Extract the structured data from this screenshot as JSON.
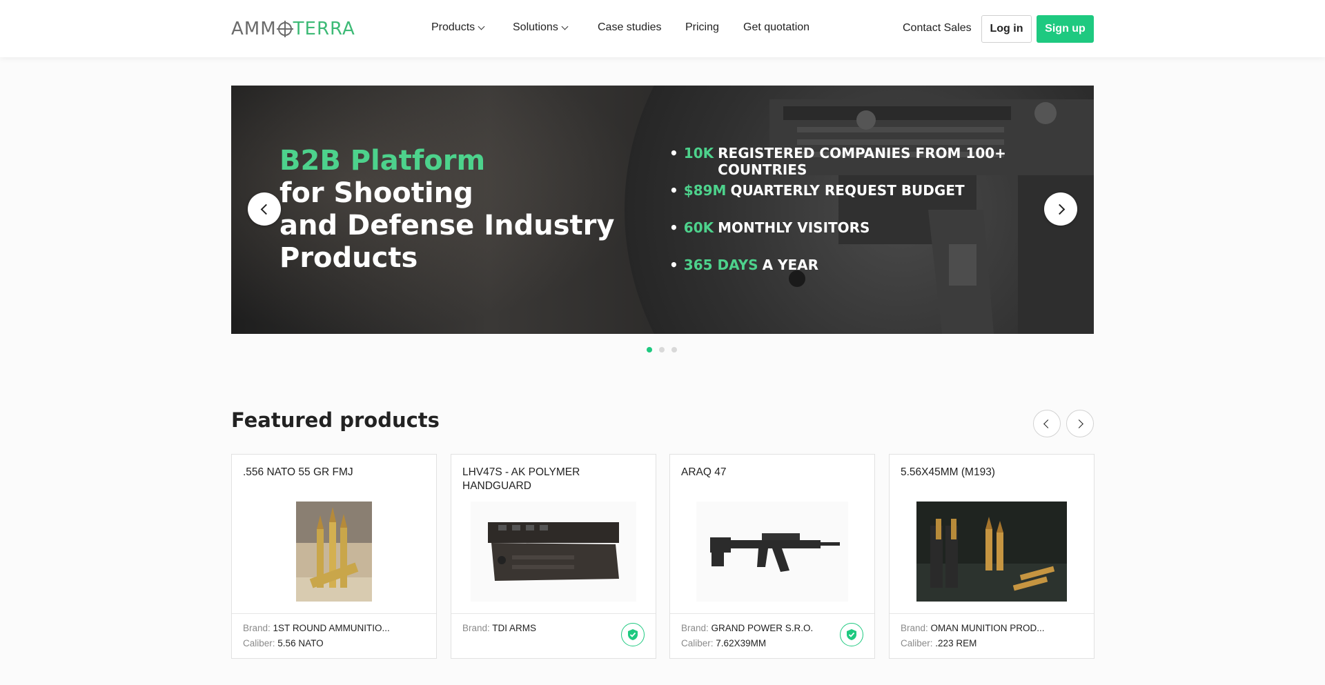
{
  "header": {
    "logo": {
      "part1": "AMM",
      "part2": "TERRA"
    },
    "nav": [
      {
        "label": "Products",
        "dropdown": true
      },
      {
        "label": "Solutions",
        "dropdown": true
      },
      {
        "label": "Case studies",
        "dropdown": false
      },
      {
        "label": "Pricing",
        "dropdown": false
      },
      {
        "label": "Get quotation",
        "dropdown": false
      }
    ],
    "contact_sales": "Contact Sales",
    "login": "Log in",
    "signup": "Sign up"
  },
  "hero": {
    "title_highlight": "B2B Platform",
    "title_line2": "for Shooting",
    "title_line3": "and Defense Industry",
    "title_line4": "Products",
    "stats": [
      {
        "value": "10K",
        "text": "REGISTERED COMPANIES FROM 100+ COUNTRIES"
      },
      {
        "value": "$89M",
        "text": "QUARTERLY REQUEST BUDGET"
      },
      {
        "value": "60K",
        "text": "MONTHLY VISITORS"
      },
      {
        "value": "365 DAYS",
        "text": "A YEAR"
      }
    ],
    "slides_total": 3,
    "active_slide": 1
  },
  "featured": {
    "title": "Featured products",
    "brand_label": "Brand:",
    "caliber_label": "Caliber:",
    "products": [
      {
        "name": ".556 NATO 55 GR FMJ",
        "brand": "1ST ROUND AMMUNITIO...",
        "caliber": "5.56 NATO",
        "verified": false
      },
      {
        "name": "LHV47S - AK POLYMER HANDGUARD",
        "brand": "TDI ARMS",
        "caliber": "",
        "verified": true
      },
      {
        "name": "ARAQ 47",
        "brand": "GRAND POWER S.R.O.",
        "caliber": "7.62X39MM",
        "verified": true
      },
      {
        "name": "5.56X45MM (M193)",
        "brand": "OMAN MUNITION PROD...",
        "caliber": ".223 REM",
        "verified": false
      }
    ]
  },
  "colors": {
    "accent": "#1ec980",
    "highlight": "#4dd28c"
  }
}
